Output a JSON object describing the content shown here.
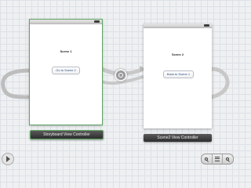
{
  "scene1": {
    "title": "Scene 1",
    "button_label": "Go to Scene 2",
    "controller_label": "Storyboard View Controller"
  },
  "scene2": {
    "title": "Scene 2",
    "button_label": "Back to Scene 1",
    "controller_label": "Scene2 View Controller"
  },
  "toolbar": {
    "play_icon": "play-icon",
    "zoom_out_icon": "zoom-out-icon",
    "zoom_fit_icon": "zoom-fit-icon",
    "zoom_in_icon": "zoom-in-icon"
  },
  "colors": {
    "selection": "#5fa463",
    "canvas": "#eef0f2",
    "segue": "#9a9a9a"
  }
}
